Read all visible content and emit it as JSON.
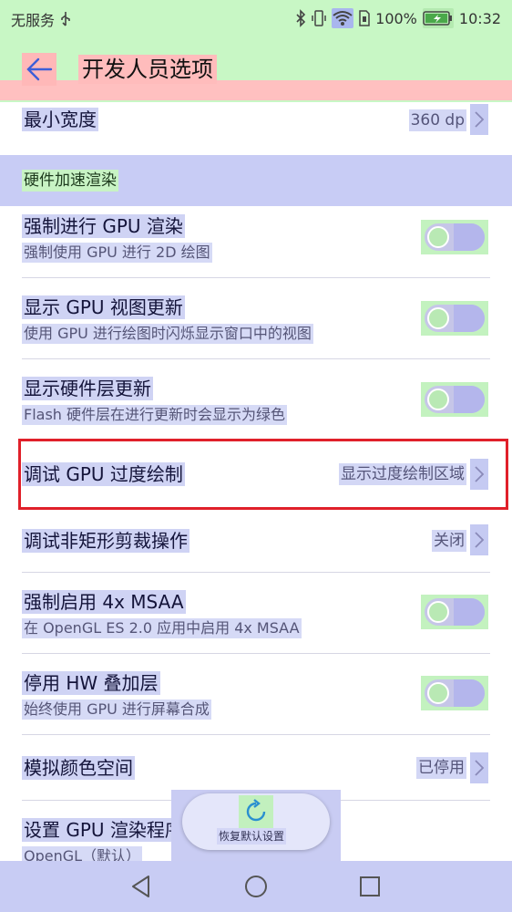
{
  "status_bar": {
    "carrier": "无服务",
    "battery": "100%",
    "time": "10:32"
  },
  "header": {
    "title": "开发人员选项"
  },
  "items": [
    {
      "title": "最小宽度",
      "value": "360 dp"
    },
    {
      "section": "硬件加速渲染"
    },
    {
      "title": "强制进行 GPU 渲染",
      "subtitle": "强制使用 GPU 进行 2D 绘图",
      "toggle": false
    },
    {
      "title": "显示 GPU 视图更新",
      "subtitle": "使用 GPU 进行绘图时闪烁显示窗口中的视图",
      "toggle": false
    },
    {
      "title": "显示硬件层更新",
      "subtitle": "Flash 硬件层在进行更新时会显示为绿色",
      "toggle": false
    },
    {
      "title": "调试 GPU 过度绘制",
      "value": "显示过度绘制区域"
    },
    {
      "title": "调试非矩形剪裁操作",
      "value": "关闭"
    },
    {
      "title": "强制启用 4x MSAA",
      "subtitle": "在 OpenGL ES 2.0 应用中启用 4x MSAA",
      "toggle": false
    },
    {
      "title": "停用 HW 叠加层",
      "subtitle": "始终使用 GPU 进行屏幕合成",
      "toggle": false
    },
    {
      "title": "模拟颜色空间",
      "value": "已停用"
    },
    {
      "title": "设置 GPU 渲染程序",
      "subtitle": "OpenGL（默认）"
    }
  ],
  "fab": {
    "label": "恢复默认设置"
  },
  "colors": {
    "highlight_border": "#e0202a",
    "accent": "#3d5ed8"
  }
}
